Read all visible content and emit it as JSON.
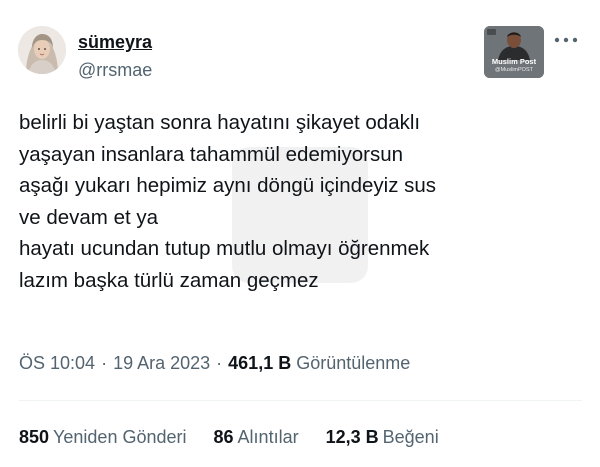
{
  "author": {
    "display_name": "sümeyra",
    "handle": "@rrsmae"
  },
  "brand": {
    "name": "Muslim Post",
    "handle": "@MuslimPOST"
  },
  "more_icon": "more-dots-icon",
  "tweet_lines": [
    "belirli bi yaştan sonra hayatını şikayet odaklı",
    "yaşayan insanlara tahammül edemiyorsun",
    "aşağı yukarı hepimiz aynı döngü içindeyiz sus",
    "ve devam et ya",
    "hayatı ucundan tutup mutlu olmayı öğrenmek",
    "lazım başka türlü zaman geçmez"
  ],
  "meta": {
    "time": "ÖS 10:04",
    "separator": "·",
    "date": "19 Ara 2023",
    "views_count": "461,1 B",
    "views_label": "Görüntülenme"
  },
  "stats": {
    "retweets_count": "850",
    "retweets_label": "Yeniden Gönderi",
    "quotes_count": "86",
    "quotes_label": "Alıntılar",
    "likes_count": "12,3 B",
    "likes_label": "Beğeni"
  }
}
